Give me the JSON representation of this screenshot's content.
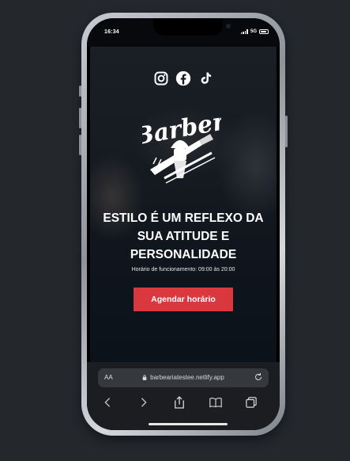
{
  "status_bar": {
    "time": "16:34",
    "network": "5G"
  },
  "site": {
    "logo_text": "Barber",
    "headline_lines": [
      "ESTILO É UM REFLEXO DA",
      "SUA ATITUDE E",
      "PERSONALIDADE"
    ],
    "hours": "Horário de funcionamento: 09:00 às 20:00",
    "cta_label": "Agendar horário",
    "accent_color": "#d9383f",
    "social_icons": [
      "instagram-icon",
      "facebook-icon",
      "tiktok-icon"
    ]
  },
  "browser": {
    "text_size_label": "AA",
    "url": "barbeariatestee.netlify.app",
    "toolbar_icons": [
      "back-icon",
      "forward-icon",
      "share-icon",
      "bookmarks-icon",
      "tabs-icon"
    ]
  }
}
